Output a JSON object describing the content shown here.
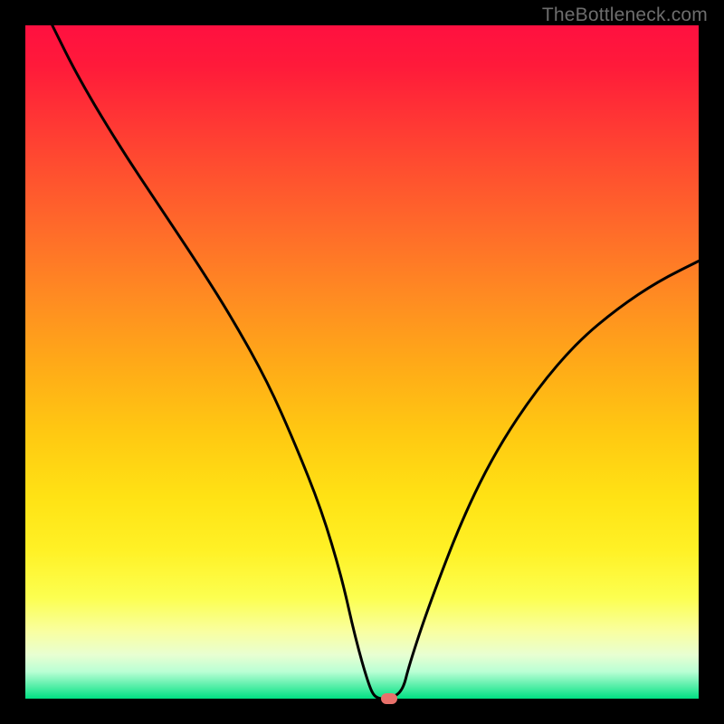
{
  "watermark": "TheBottleneck.com",
  "chart_data": {
    "type": "line",
    "title": "",
    "xlabel": "",
    "ylabel": "",
    "xlim": [
      0,
      100
    ],
    "ylim": [
      0,
      100
    ],
    "background_gradient": {
      "stops": [
        {
          "pos": 0,
          "color": "#ff1040"
        },
        {
          "pos": 20,
          "color": "#ff4a30"
        },
        {
          "pos": 40,
          "color": "#ff8a22"
        },
        {
          "pos": 60,
          "color": "#ffc712"
        },
        {
          "pos": 80,
          "color": "#fff126"
        },
        {
          "pos": 94,
          "color": "#e8ffd2"
        },
        {
          "pos": 100,
          "color": "#00e083"
        }
      ]
    },
    "series": [
      {
        "name": "bottleneck-curve",
        "color": "#000000",
        "x": [
          4,
          8,
          14,
          20,
          26,
          31,
          36,
          40,
          44,
          47,
          49,
          51,
          52,
          54,
          56,
          57,
          60,
          65,
          70,
          76,
          82,
          88,
          94,
          100
        ],
        "y": [
          100,
          92,
          82,
          73,
          64,
          56,
          47,
          38,
          28,
          18,
          9,
          2,
          0,
          0,
          1,
          5,
          14,
          27,
          37,
          46,
          53,
          58,
          62,
          65
        ]
      }
    ],
    "marker": {
      "x": 54,
      "y": 0,
      "color": "#e8716b"
    }
  }
}
